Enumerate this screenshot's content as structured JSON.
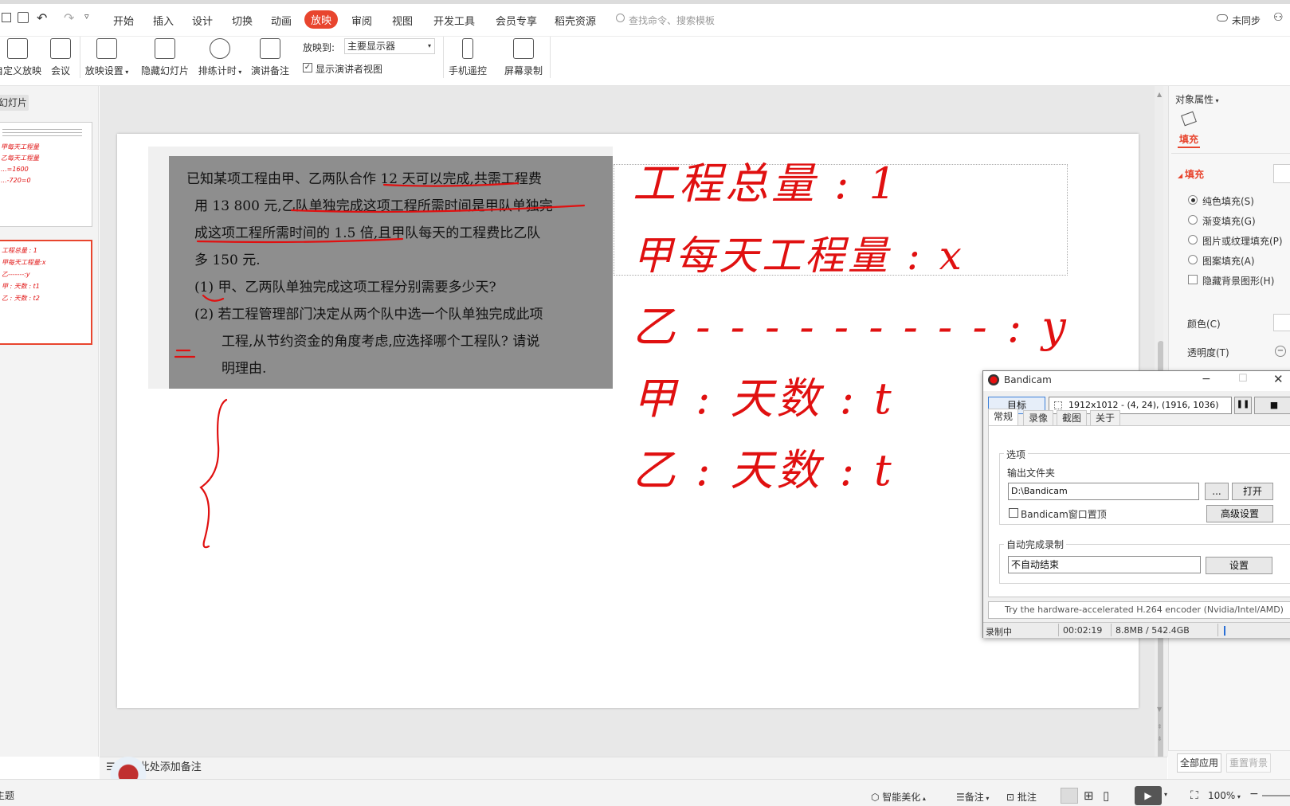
{
  "menu": {
    "tabs": [
      "开始",
      "插入",
      "设计",
      "切换",
      "动画",
      "放映",
      "审阅",
      "视图",
      "开发工具",
      "会员专享",
      "稻壳资源"
    ],
    "search_placeholder": "查找命令、搜索模板",
    "sync_label": "未同步"
  },
  "ribbon": {
    "custom_show": "自定义放映",
    "meeting": "会议",
    "show_settings": "放映设置",
    "hide_slide": "隐藏幻灯片",
    "rehearse": "排练计时",
    "speaker_notes": "演讲备注",
    "show_to_label": "放映到:",
    "show_to_value": "主要显示器",
    "presenter_view": "显示演讲者视图",
    "phone_remote": "手机遥控",
    "screen_record": "屏幕录制"
  },
  "sidebar": {
    "title": "幻灯片"
  },
  "notes": {
    "placeholder": "单击此处添加备注"
  },
  "slide": {
    "problem_lines": [
      "已知某项工程由甲、乙两队合作 12 天可以完成,共需工程费",
      "用 13 800 元,乙队单独完成这项工程所需时间是甲队单独完",
      "成这项工程所需时间的 1.5 倍,且甲队每天的工程费比乙队",
      "多 150 元.",
      "(1) 甲、乙两队单独完成这项工程分别需要多少天?",
      "(2) 若工程管理部门决定从两个队中选一个队单独完成此项",
      "工程,从节约资金的角度考虑,应选择哪个工程队? 请说",
      "明理由."
    ],
    "handwriting": [
      "工程总量 : 1",
      "甲每天工程量 : x",
      "乙 - - - - - - - - - : y",
      "甲 : 天数 : t",
      "乙 : 天数 : t"
    ]
  },
  "thumb": {
    "s1_lines": [
      "甲每天工程量",
      "乙每天工程量",
      "...=1600",
      "...-720=0"
    ],
    "s2_lines": [
      "工程总量 : 1",
      "甲每天工程量:x",
      "乙-------:y",
      "甲 : 天数 : t1",
      "乙 : 天数 : t2"
    ]
  },
  "properties": {
    "title": "对象属性",
    "tab_fill": "填充",
    "section_fill": "填充",
    "options": [
      "纯色填充(S)",
      "渐变填充(G)",
      "图片或纹理填充(P)",
      "图案填充(A)"
    ],
    "hide_bg": "隐藏背景图形(H)",
    "color_label": "颜色(C)",
    "transparency_label": "透明度(T)",
    "apply_all": "全部应用",
    "reset_bg": "重置背景"
  },
  "bandicam": {
    "title": "Bandicam",
    "target_button": "目标",
    "region": "1912x1012 - (4, 24), (1916, 1036)",
    "tabs": [
      "常规",
      "录像",
      "截图",
      "关于"
    ],
    "options_label": "选项",
    "output_folder_label": "输出文件夹",
    "output_folder": "D:\\Bandicam",
    "browse": "...",
    "open": "打开",
    "topmost": "Bandicam窗口置顶",
    "advanced": "高级设置",
    "auto_complete_label": "自动完成录制",
    "auto_complete_value": "不自动结束",
    "settings": "设置",
    "hint": "Try the hardware-accelerated H.264 encoder (Nvidia/Intel/AMD)",
    "status": "录制中",
    "time": "00:02:19",
    "size": "8.8MB / 542.4GB"
  },
  "statusbar": {
    "left": "主题",
    "beautify": "智能美化",
    "notes": "备注",
    "comments": "批注",
    "zoom": "100%"
  },
  "colors": {
    "accent": "#e8452e",
    "ink": "#e01010"
  }
}
